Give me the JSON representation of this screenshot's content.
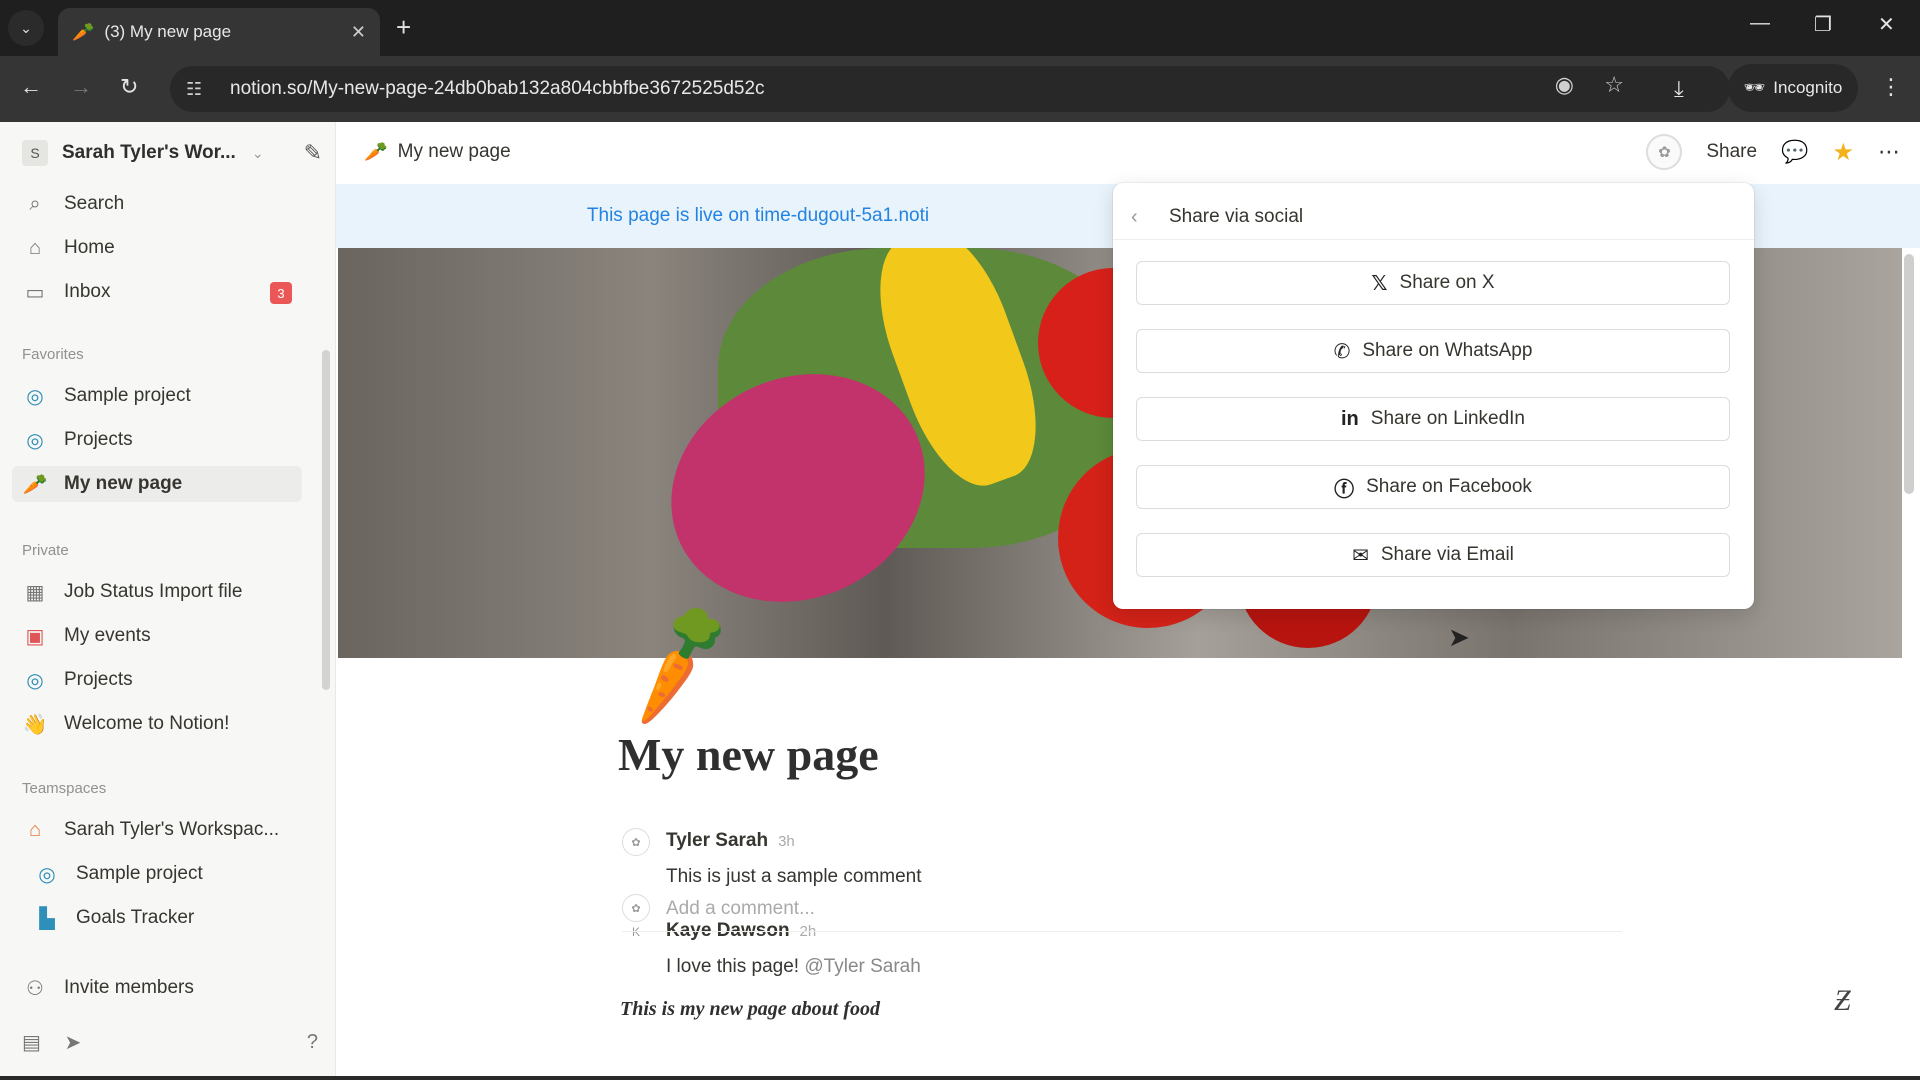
{
  "browser": {
    "tab_title": "(3) My new page",
    "url": "notion.so/My-new-page-24db0bab132a804cbbfbe3672525d52c",
    "incognito_label": "Incognito"
  },
  "sidebar": {
    "workspace_initial": "S",
    "workspace_name": "Sarah Tyler's Wor...",
    "top_items": [
      {
        "label": "Search",
        "icon": "search-icon"
      },
      {
        "label": "Home",
        "icon": "home-icon"
      },
      {
        "label": "Inbox",
        "icon": "inbox-icon",
        "badge": "3"
      }
    ],
    "favorites_label": "Favorites",
    "favorites": [
      {
        "label": "Sample project"
      },
      {
        "label": "Projects"
      },
      {
        "label": "My new page"
      }
    ],
    "private_label": "Private",
    "private": [
      {
        "label": "Job Status Import file"
      },
      {
        "label": "My events"
      },
      {
        "label": "Projects"
      },
      {
        "label": "Welcome to Notion!"
      }
    ],
    "teamspaces_label": "Teamspaces",
    "teamspaces": [
      {
        "label": "Sarah Tyler's Workspac..."
      },
      {
        "label": "Sample project"
      },
      {
        "label": "Goals Tracker"
      }
    ],
    "invite_label": "Invite members"
  },
  "topbar": {
    "breadcrumb": "My new page",
    "share_label": "Share"
  },
  "banner": {
    "text": "This page is live on time-dugout-5a1.noti"
  },
  "page": {
    "title": "My new page",
    "comments": [
      {
        "author": "Tyler Sarah",
        "time": "3h",
        "text": "This is just a sample comment",
        "mention": ""
      },
      {
        "author": "Kaye Dawson",
        "time": "2h",
        "text": "I love this page! ",
        "mention": "@Tyler Sarah"
      }
    ],
    "add_comment_placeholder": "Add a comment...",
    "body_text": "This is my new page about food"
  },
  "share_popup": {
    "title": "Share via social",
    "buttons": [
      {
        "label": "Share on X",
        "icon": "x-logo-icon"
      },
      {
        "label": "Share on WhatsApp",
        "icon": "whatsapp-icon"
      },
      {
        "label": "Share on LinkedIn",
        "icon": "linkedin-icon"
      },
      {
        "label": "Share on Facebook",
        "icon": "facebook-icon"
      },
      {
        "label": "Share via Email",
        "icon": "email-icon"
      }
    ]
  }
}
